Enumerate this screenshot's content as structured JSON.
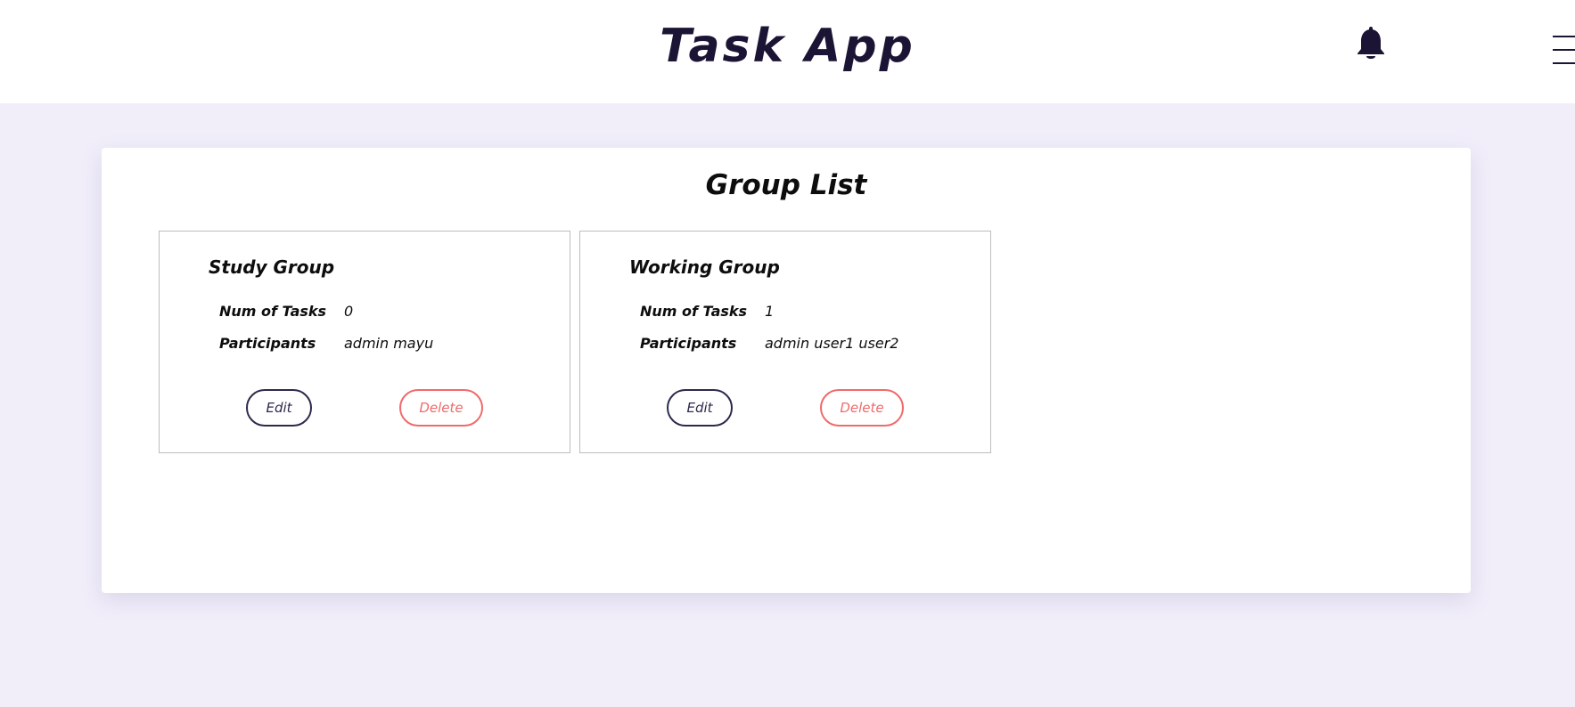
{
  "header": {
    "title": "Task App",
    "notification_icon": "bell-icon",
    "menu_icon": "hamburger-menu-icon"
  },
  "main": {
    "title": "Group List",
    "groups": [
      {
        "name": "Study Group",
        "tasks_label": "Num of Tasks",
        "tasks_value": "0",
        "participants_label": "Participants",
        "participants_value": "admin mayu",
        "edit_label": "Edit",
        "delete_label": "Delete"
      },
      {
        "name": "Working Group",
        "tasks_label": "Num of Tasks",
        "tasks_value": "1",
        "participants_label": "Participants",
        "participants_value": "admin user1 user2",
        "edit_label": "Edit",
        "delete_label": "Delete"
      }
    ]
  },
  "colors": {
    "background": "#f1eefa",
    "title_dark": "#1b1434",
    "edit_border": "#2b2a4c",
    "delete_accent": "#f06a6a"
  }
}
